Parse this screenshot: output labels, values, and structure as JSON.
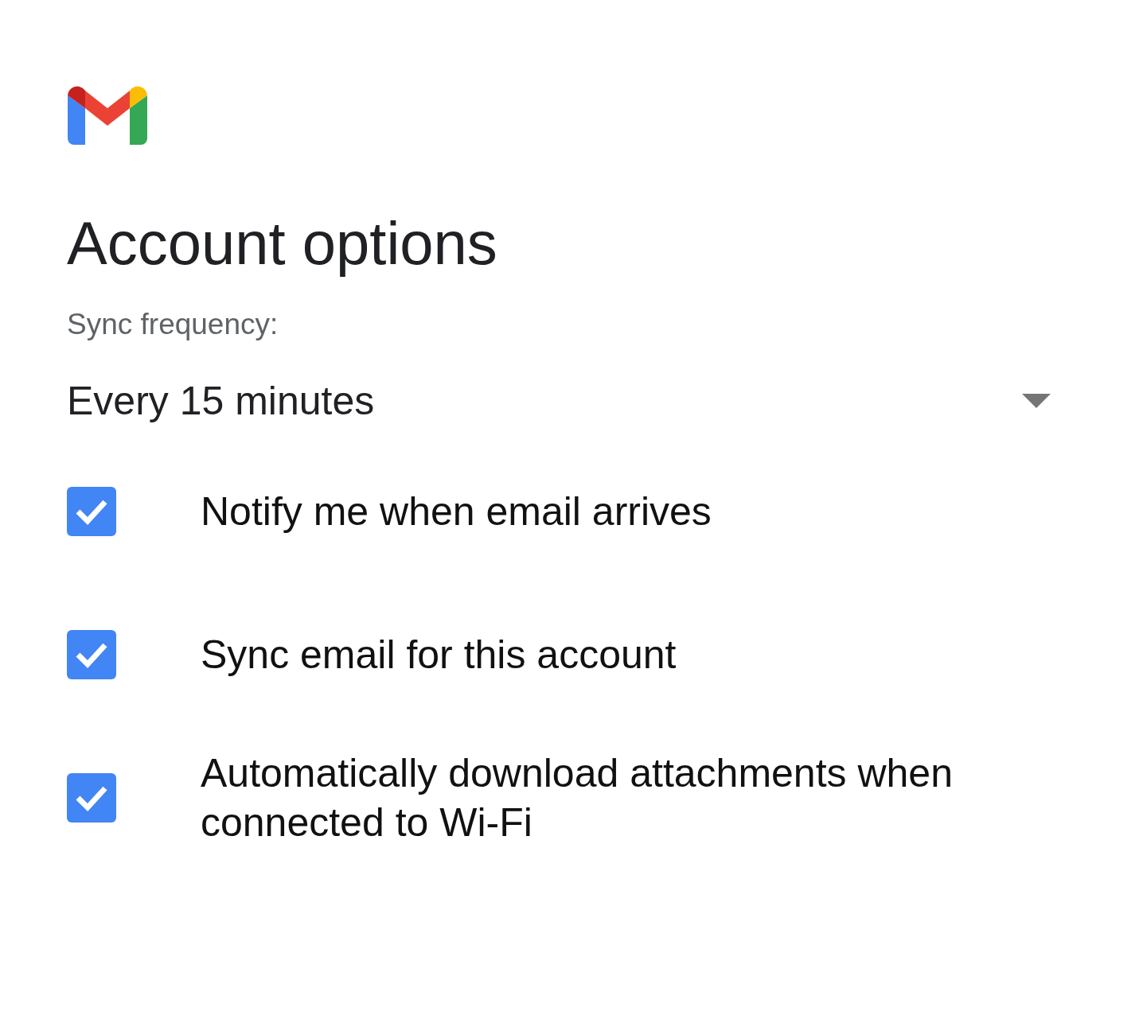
{
  "title": "Account options",
  "sync_frequency": {
    "label": "Sync frequency:",
    "value": "Every 15 minutes"
  },
  "options": [
    {
      "label": "Notify me when email arrives",
      "checked": true
    },
    {
      "label": "Sync email for this account",
      "checked": true
    },
    {
      "label": "Automatically download attachments when connected to Wi-Fi",
      "checked": true
    }
  ]
}
